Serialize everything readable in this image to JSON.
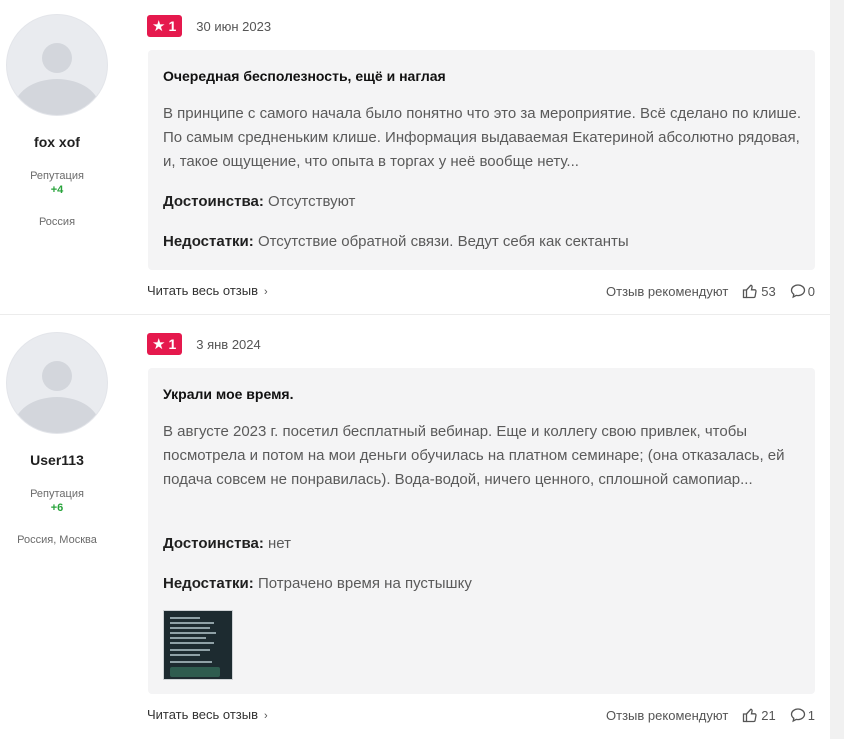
{
  "reviews": [
    {
      "user": {
        "name": "fox xof",
        "reputation_label": "Репутация",
        "reputation_value": "+4",
        "location": "Россия"
      },
      "rating": "1",
      "date": "30 июн 2023",
      "title": "Очередная бесполезность, ещё и наглая",
      "text": "В принципе с самого начала было понятно что это за мероприятие. Всё сделано по клише. По самым средненьким клише. Информация выдаваемая Екатериной абсолютно рядовая, и, такое ощущение, что опыта в торгах у неё вообще нету...",
      "pros_label": "Достоинства:",
      "pros": "Отсутствуют",
      "cons_label": "Недостатки:",
      "cons": "Отсутствие обратной связи. Ведут себя как сектанты",
      "read_more": "Читать весь отзыв",
      "recommend": "Отзыв рекомендуют",
      "likes": "53",
      "comments": "0"
    },
    {
      "user": {
        "name": "User113",
        "reputation_label": "Репутация",
        "reputation_value": "+6",
        "location": "Россия, Москва"
      },
      "rating": "1",
      "date": "3 янв 2024",
      "title": "Украли мое время.",
      "text": "В августе 2023 г. посетил бесплатный вебинар. Еще и коллегу свою привлек, чтобы посмотрела и потом на мои деньги обучилась на платном семинаре; (она отказалась, ей подача совсем не понравилась). Вода-водой, ничего ценного, сплошной самопиар...",
      "pros_label": "Достоинства:",
      "pros": "нет",
      "cons_label": "Недостатки:",
      "cons": "Потрачено время на пустышку",
      "read_more": "Читать весь отзыв",
      "recommend": "Отзыв рекомендуют",
      "likes": "21",
      "comments": "1"
    }
  ],
  "colors": {
    "rating_badge": "#e5194d",
    "reputation_positive": "#27a33a",
    "card_bg": "#f4f4f5"
  },
  "icons": {
    "star": "star-icon",
    "chevron": "chevron-right-icon",
    "like": "thumbs-up-icon",
    "comment": "comment-icon",
    "avatar": "user-avatar-icon"
  }
}
